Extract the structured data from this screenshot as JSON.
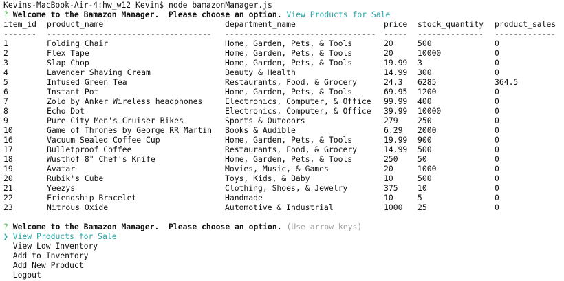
{
  "prompt_line": "Kevins-MacBook-Air-4:hw_w12 Kevin$ node bamazonManager.js",
  "first_question": {
    "mark": "?",
    "text": "Welcome to the Bamazon Manager.  Please choose an option.",
    "answer": "View Products for Sale"
  },
  "table": {
    "headers": [
      "item_id",
      "product_name",
      "department_name",
      "price",
      "stock_quantity",
      "product_sales"
    ],
    "rules": [
      "-------",
      "-----------------------------------",
      "--------------------------------",
      "-----",
      "--------------",
      "-------------"
    ],
    "rows": [
      [
        "1",
        "Folding Chair",
        "Home, Garden, Pets, & Tools",
        "20",
        "500",
        "0"
      ],
      [
        "2",
        "Flex Tape",
        "Home, Garden, Pets, & Tools",
        "20",
        "10000",
        "0"
      ],
      [
        "3",
        "Slap Chop",
        "Home, Garden, Pets, & Tools",
        "19.99",
        "3",
        "0"
      ],
      [
        "4",
        "Lavender Shaving Cream",
        "Beauty & Health",
        "14.99",
        "300",
        "0"
      ],
      [
        "5",
        "Infused Green Tea",
        "Restaurants, Food, & Grocery",
        "24.3",
        "6285",
        "364.5"
      ],
      [
        "6",
        "Instant Pot",
        "Home, Garden, Pets, & Tools",
        "69.95",
        "1200",
        "0"
      ],
      [
        "7",
        "Zolo by Anker Wireless headphones",
        "Electronics, Computer, & Office",
        "99.99",
        "400",
        "0"
      ],
      [
        "8",
        "Echo Dot",
        "Electronics, Computer, & Office",
        "39.99",
        "10000",
        "0"
      ],
      [
        "9",
        "Pure City Men's Cruiser Bikes",
        "Sports & Outdoors",
        "279",
        "250",
        "0"
      ],
      [
        "10",
        "Game of Thrones by George RR Martin",
        "Books & Audible",
        "6.29",
        "2000",
        "0"
      ],
      [
        "16",
        "Vacuum Sealed Coffee Cup",
        "Home, Garden, Pets, & Tools",
        "19.99",
        "900",
        "0"
      ],
      [
        "17",
        "Bulletproof Coffee",
        "Restaurants, Food, & Grocery",
        "14.99",
        "500",
        "0"
      ],
      [
        "18",
        "Wusthof 8\" Chef's Knife",
        "Home, Garden, Pets, & Tools",
        "250",
        "50",
        "0"
      ],
      [
        "19",
        "Avatar",
        "Movies, Music, & Games",
        "20",
        "1000",
        "0"
      ],
      [
        "20",
        "Rubik's Cube",
        "Toys, Kids, & Baby",
        "10",
        "500",
        "0"
      ],
      [
        "21",
        "Yeezys",
        "Clothing, Shoes, & Jewelry",
        "375",
        "10",
        "0"
      ],
      [
        "22",
        "Friendship Bracelet",
        "Handmade",
        "10",
        "5",
        "0"
      ],
      [
        "23",
        "Nitrous Oxide",
        "Automotive & Industrial",
        "1000",
        "25",
        "0"
      ]
    ]
  },
  "second_question": {
    "mark": "?",
    "text": "Welcome to the Bamazon Manager.  Please choose an option.",
    "hint": "(Use arrow keys)"
  },
  "menu": {
    "pointer": "❯",
    "selected_index": 0,
    "items": [
      "View Products for Sale",
      "View Low Inventory",
      "Add to Inventory",
      "Add New Product",
      "Logout"
    ]
  },
  "colors": {
    "question_mark": "#3fb93f",
    "answer": "#23a6a6",
    "selected": "#23a6a6",
    "hint": "#9a9a9a"
  }
}
